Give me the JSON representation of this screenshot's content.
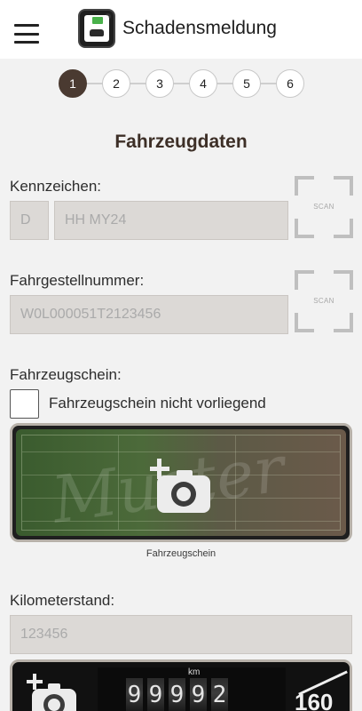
{
  "appbar": {
    "title": "Schadensmeldung",
    "menu_icon": "hamburger-menu-icon",
    "logo_icon": "app-logo-icon"
  },
  "stepper": {
    "steps": [
      "1",
      "2",
      "3",
      "4",
      "5",
      "6"
    ],
    "active": 1,
    "active_color": "#4a3a31"
  },
  "section_title": "Fahrzeugdaten",
  "kennzeichen": {
    "label": "Kennzeichen:",
    "country_value": "D",
    "plate_value": "HH MY24",
    "scan_label": "SCAN"
  },
  "fahrgestellnummer": {
    "label": "Fahrgestellnummer:",
    "value": "W0L000051T2123456",
    "scan_label": "SCAN"
  },
  "fahrzeugschein": {
    "label": "Fahrzeugschein:",
    "checkbox_label": "Fahrzeugschein nicht vorliegend",
    "checked": false,
    "photo_caption": "Fahrzeugschein"
  },
  "kilometerstand": {
    "label": "Kilometerstand:",
    "value": "123456",
    "odometer_digits": [
      "9",
      "9",
      "9",
      "9",
      "2"
    ],
    "odometer_unit": "km",
    "speed_mark": "160"
  }
}
